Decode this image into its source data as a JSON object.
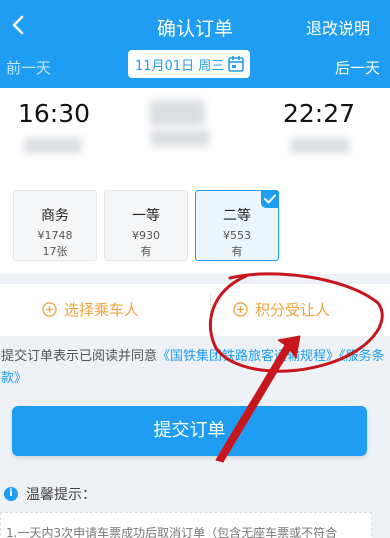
{
  "header": {
    "title": "确认订单",
    "refund_label": "退改说明",
    "prev_day": "前一天",
    "next_day": "后一天",
    "date": "11月01日 周三"
  },
  "train": {
    "depart_time": "16:30",
    "arrive_time": "22:27"
  },
  "seats": [
    {
      "name": "商务",
      "price": "¥1748",
      "availability": "17张"
    },
    {
      "name": "一等",
      "price": "¥930",
      "availability": "有"
    },
    {
      "name": "二等",
      "price": "¥553",
      "availability": "有"
    }
  ],
  "selected_seat": "二等",
  "options": {
    "add_passenger": "选择乘车人",
    "points_beneficiary": "积分受让人"
  },
  "agreement": {
    "prefix": "提交订单表示已阅读并同意",
    "link": "《国铁集团铁路旅客运输规程》《服务条款》"
  },
  "submit_label": "提交订单",
  "tips": {
    "title": "温馨提示：",
    "line1": "1.一天内3次申请车票成功后取消订单（包含无座车票或不符合"
  },
  "colors": {
    "primary": "#1e9df2",
    "accent": "#f0a33d",
    "annotation": "#c8161d"
  }
}
